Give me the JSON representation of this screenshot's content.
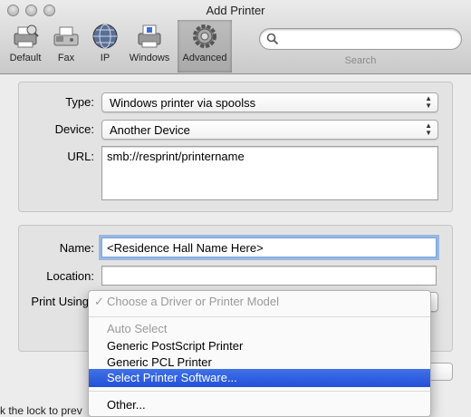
{
  "window": {
    "title": "Add Printer"
  },
  "toolbar": {
    "items": [
      {
        "label": "Default",
        "icon": "default-printer-icon"
      },
      {
        "label": "Fax",
        "icon": "fax-icon"
      },
      {
        "label": "IP",
        "icon": "globe-icon"
      },
      {
        "label": "Windows",
        "icon": "windows-printer-icon"
      },
      {
        "label": "Advanced",
        "icon": "gear-icon"
      }
    ],
    "selected": "Advanced",
    "search": {
      "placeholder": "",
      "label": "Search"
    }
  },
  "connection": {
    "type_label": "Type:",
    "type_value": "Windows printer via spoolss",
    "device_label": "Device:",
    "device_value": "Another Device",
    "url_label": "URL:",
    "url_value": "smb://resprint/printername"
  },
  "details": {
    "name_label": "Name:",
    "name_value": "<Residence Hall Name Here>",
    "location_label": "Location:",
    "location_value": "",
    "print_using_label": "Print Using"
  },
  "driver_menu": {
    "header": "Choose a Driver or Printer Model",
    "items": [
      {
        "label": "Auto Select",
        "state": "disabled"
      },
      {
        "label": "Generic PostScript Printer",
        "state": "normal"
      },
      {
        "label": "Generic PCL Printer",
        "state": "normal"
      },
      {
        "label": "Select Printer Software...",
        "state": "highlighted"
      },
      {
        "label": "Other...",
        "state": "normal"
      }
    ]
  },
  "footer": {
    "lock_text": "k the lock to prev"
  },
  "colors": {
    "highlight": "#2f5fe0",
    "focus_ring": "#5d94e0",
    "window_bg": "#ececec"
  }
}
